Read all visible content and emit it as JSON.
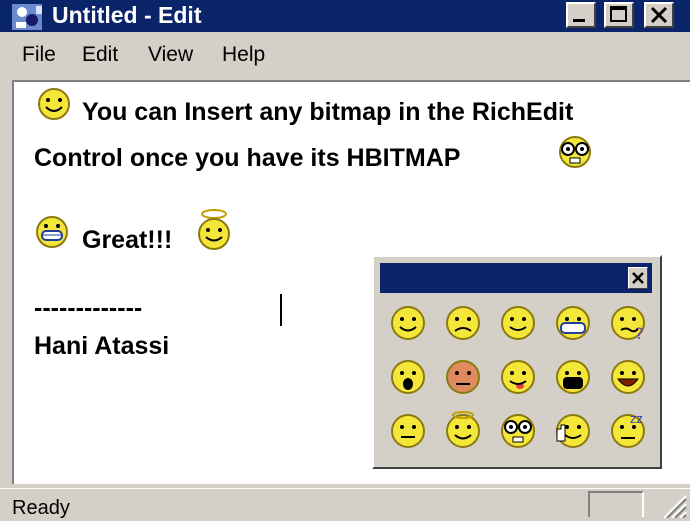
{
  "window": {
    "title": "Untitled - Edit"
  },
  "menu": {
    "items": [
      "File",
      "Edit",
      "View",
      "Help"
    ]
  },
  "document": {
    "line1": "You can Insert any bitmap in the RichEdit",
    "line2": "Control once you have its  HBITMAP",
    "line3": "Great!!!",
    "line4": "-------------",
    "line5": "Hani Atassi"
  },
  "palette": {
    "emoticons": [
      "smile-emoticon",
      "sad-emoticon",
      "wink-emoticon",
      "mask-emoticon",
      "confused-emoticon",
      "surprised-emoticon",
      "angry-emoticon",
      "tongue-emoticon",
      "shout-emoticon",
      "laugh-emoticon",
      "neutral-emoticon",
      "angel-emoticon",
      "nerd-emoticon",
      "wave-emoticon",
      "sleepy-emoticon"
    ]
  },
  "status": {
    "text": "Ready"
  },
  "colors": {
    "titlebar": "#0a246a",
    "face": "#d4d0c8",
    "emoticon_yellow": "#f5e63a"
  }
}
